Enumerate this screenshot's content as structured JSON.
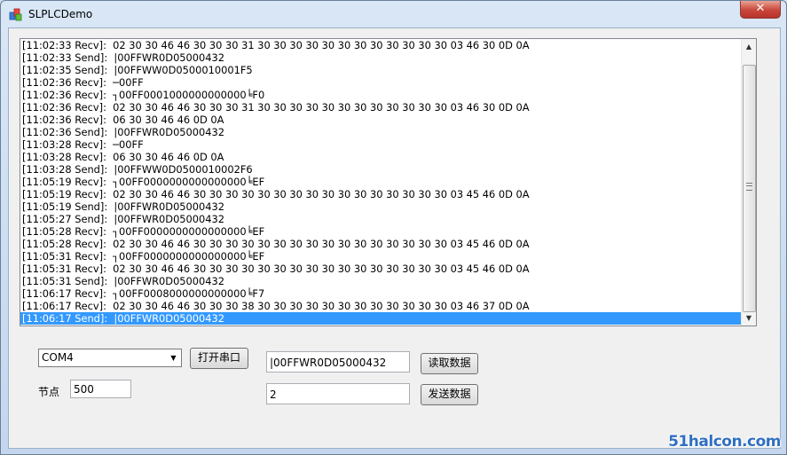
{
  "window": {
    "title": "SLPLCDemo",
    "close_label": "✕"
  },
  "log": {
    "lines": [
      "[11:02:33 Recv]:  02 30 30 46 46 30 30 30 31 30 30 30 30 30 30 30 30 30 30 30 30 03 46 30 0D 0A",
      "[11:02:33 Send]:  |00FFWR0D05000432",
      "[11:02:35 Send]:  |00FFWW0D0500010001F5",
      "[11:02:36 Recv]:  ─00FF",
      "[11:02:36 Recv]:  ┐00FF0001000000000000╘F0",
      "[11:02:36 Recv]:  02 30 30 46 46 30 30 30 31 30 30 30 30 30 30 30 30 30 30 30 30 03 46 30 0D 0A",
      "[11:02:36 Recv]:  06 30 30 46 46 0D 0A",
      "[11:02:36 Send]:  |00FFWR0D05000432",
      "[11:03:28 Recv]:  ─00FF",
      "[11:03:28 Recv]:  06 30 30 46 46 0D 0A",
      "[11:03:28 Send]:  |00FFWW0D0500010002F6",
      "[11:05:19 Recv]:  ┐00FF0000000000000000╘EF",
      "[11:05:19 Recv]:  02 30 30 46 46 30 30 30 30 30 30 30 30 30 30 30 30 30 30 30 30 03 45 46 0D 0A",
      "[11:05:19 Send]:  |00FFWR0D05000432",
      "[11:05:27 Send]:  |00FFWR0D05000432",
      "[11:05:28 Recv]:  ┐00FF0000000000000000╘EF",
      "[11:05:28 Recv]:  02 30 30 46 46 30 30 30 30 30 30 30 30 30 30 30 30 30 30 30 30 03 45 46 0D 0A",
      "[11:05:31 Recv]:  ┐00FF0000000000000000╘EF",
      "[11:05:31 Recv]:  02 30 30 46 46 30 30 30 30 30 30 30 30 30 30 30 30 30 30 30 30 03 45 46 0D 0A",
      "[11:05:31 Send]:  |00FFWR0D05000432",
      "[11:06:17 Recv]:  ┐00FF0008000000000000╘F7",
      "[11:06:17 Recv]:  02 30 30 46 46 30 30 30 38 30 30 30 30 30 30 30 30 30 30 30 30 03 46 37 0D 0A",
      "[11:06:17 Send]:  |00FFWR0D05000432"
    ],
    "selected_index": 22
  },
  "controls": {
    "port_value": "COM4",
    "open_port_label": "打开串口",
    "node_label": "节点",
    "node_value": "500",
    "command_value": "|00FFWR0D05000432",
    "data_value": "2",
    "read_label": "读取数据",
    "send_label": "发送数据"
  },
  "watermark": "51halcon.com"
}
